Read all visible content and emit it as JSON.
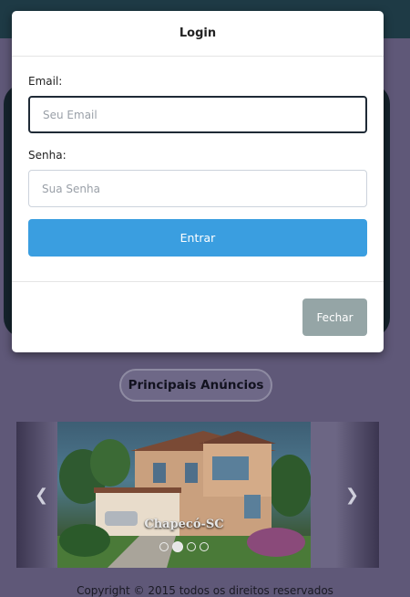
{
  "modal": {
    "title": "Login",
    "email_label": "Email:",
    "email_placeholder": "Seu Email",
    "email_value": "",
    "password_label": "Senha:",
    "password_placeholder": "Sua Senha",
    "password_value": "",
    "login_button": "Entrar",
    "close_button": "Fechar"
  },
  "background": {
    "section_button": "Principais Anúncios",
    "carousel": {
      "caption": "Chapecó-SC",
      "slide_count": 4,
      "active_slide": 1,
      "prev_icon": "chevron-left-icon",
      "next_icon": "chevron-right-icon"
    },
    "footer_text": "Copyright © 2015 todos os direitos reservados"
  },
  "colors": {
    "primary_button": "#3a9ee0",
    "secondary_button": "#95a5a6",
    "backdrop": "#5f5878"
  }
}
